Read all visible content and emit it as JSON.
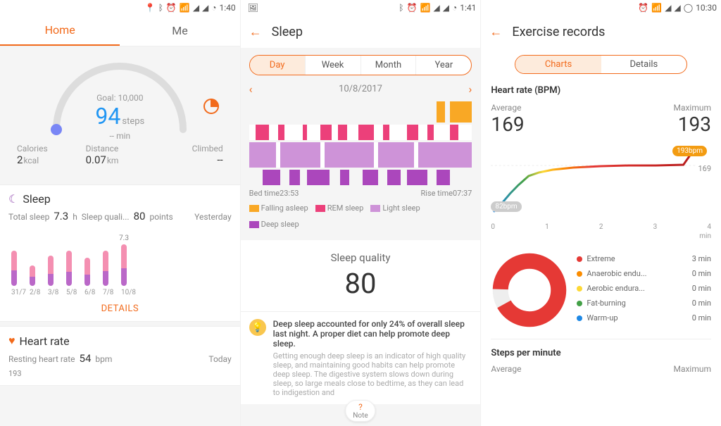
{
  "screen1": {
    "status_time": "1:40",
    "tabs": {
      "home": "Home",
      "me": "Me"
    },
    "goal_label": "Goal: 10,000",
    "steps_value": "94",
    "steps_unit": "steps",
    "mins": "-- min",
    "metrics": {
      "cal": {
        "label": "Calories",
        "value": "2",
        "unit": "kcal"
      },
      "dist": {
        "label": "Distance",
        "value": "0.07",
        "unit": "km"
      },
      "climb": {
        "label": "Climbed",
        "value": "--",
        "unit": ""
      }
    },
    "sleep": {
      "title": "Sleep",
      "total_label": "Total sleep",
      "total_value": "7.3",
      "total_unit": "h",
      "quality_label": "Sleep quali...",
      "quality_value": "80",
      "quality_unit": "points",
      "meta_right": "Yesterday",
      "last_bar_top": "7.3",
      "days": [
        "31/7",
        "2/8",
        "3/8",
        "5/8",
        "6/8",
        "7/8",
        "10/8"
      ],
      "details_btn": "DETAILS"
    },
    "heart": {
      "title": "Heart rate",
      "resting_label": "Resting heart rate",
      "resting_value": "54",
      "resting_unit": "bpm",
      "meta_right": "Today",
      "max": "193"
    }
  },
  "screen2": {
    "status_time": "1:41",
    "title": "Sleep",
    "period_tabs": {
      "day": "Day",
      "week": "Week",
      "month": "Month",
      "year": "Year"
    },
    "date": "10/8/2017",
    "bed": {
      "label": "Bed time",
      "value": "23:53"
    },
    "rise": {
      "label": "Rise time",
      "value": "07:37"
    },
    "legend": {
      "falling": "Falling asleep",
      "rem": "REM sleep",
      "light": "Light sleep",
      "deep": "Deep sleep"
    },
    "quality": {
      "title": "Sleep quality",
      "value": "80"
    },
    "tip": {
      "strong": "Deep sleep accounted for only 24% of overall sleep last night. A proper diet can help promote deep sleep.",
      "grey": "Getting enough deep sleep is an indicator of high quality sleep, and maintaining good habits can help promote deep sleep. The digestive system slows down during sleep, so large meals close to bedtime, as they can lead to indigestion and"
    },
    "note": "Note"
  },
  "screen3": {
    "status_time": "10:30",
    "title": "Exercise records",
    "tabs": {
      "charts": "Charts",
      "details": "Details"
    },
    "hr_title": "Heart rate (BPM)",
    "avg": {
      "label": "Average",
      "value": "169"
    },
    "max": {
      "label": "Maximum",
      "value": "193"
    },
    "badge_max": "193bpm",
    "badge_min": "82bpm",
    "line_end": "169",
    "xticks": [
      "0",
      "1",
      "2",
      "3",
      "4"
    ],
    "xunit": "min",
    "zones": [
      {
        "color": "#e53935",
        "label": "Extreme",
        "value": "3 min"
      },
      {
        "color": "#fb8c00",
        "label": "Anaerobic endu...",
        "value": "0 min"
      },
      {
        "color": "#fdd835",
        "label": "Aerobic endura...",
        "value": "0 min"
      },
      {
        "color": "#43a047",
        "label": "Fat-burning",
        "value": "0 min"
      },
      {
        "color": "#1e88e5",
        "label": "Warm-up",
        "value": "0 min"
      }
    ],
    "spm": {
      "title": "Steps per minute",
      "avg": "Average",
      "max": "Maximum"
    }
  },
  "chart_data": [
    {
      "type": "bar",
      "id": "daily_sleep_bars",
      "categories": [
        "31/7",
        "2/8",
        "3/8",
        "5/8",
        "6/8",
        "7/8",
        "10/8"
      ],
      "series": [
        {
          "name": "rem_hours",
          "color": "#f48fb1",
          "values": [
            2.1,
            1.3,
            2.0,
            2.3,
            1.8,
            2.2,
            2.6
          ]
        },
        {
          "name": "deep_hours",
          "color": "#ba68c8",
          "values": [
            1.7,
            1.0,
            1.3,
            1.6,
            1.2,
            1.6,
            1.9
          ]
        }
      ],
      "annotations": [
        {
          "category": "10/8",
          "text": "7.3"
        }
      ]
    },
    {
      "type": "line",
      "id": "heart_rate_over_time",
      "title": "Heart rate (BPM)",
      "xlabel": "min",
      "ylabel": "bpm",
      "xlim": [
        0,
        4
      ],
      "ylim": [
        80,
        200
      ],
      "x": [
        0.0,
        0.2,
        0.5,
        0.8,
        1.0,
        1.5,
        2.0,
        2.5,
        3.0,
        3.5,
        3.7
      ],
      "values": [
        82,
        100,
        125,
        150,
        160,
        165,
        168,
        169,
        169,
        170,
        193
      ],
      "annotations": [
        {
          "x": 0.0,
          "y": 82,
          "text": "82bpm"
        },
        {
          "x": 3.7,
          "y": 193,
          "text": "193bpm"
        },
        {
          "x": 4.0,
          "y": 169,
          "text": "169"
        }
      ]
    },
    {
      "type": "pie",
      "id": "hr_zone_ring",
      "categories": [
        "Extreme",
        "Anaerobic endurance",
        "Aerobic endurance",
        "Fat-burning",
        "Warm-up"
      ],
      "values": [
        3,
        0,
        0,
        0,
        0
      ],
      "unit": "min",
      "colors": [
        "#e53935",
        "#fb8c00",
        "#fdd835",
        "#43a047",
        "#1e88e5"
      ]
    }
  ]
}
